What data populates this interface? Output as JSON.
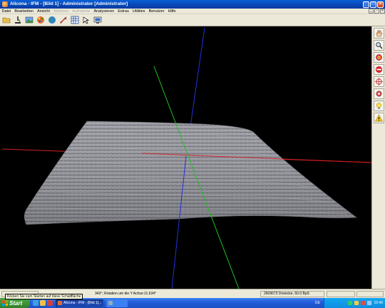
{
  "window": {
    "title": "Alicona - IFM - [Bild 1] - Administrator [Administrator]"
  },
  "menu": [
    {
      "label": "Datei",
      "enabled": true
    },
    {
      "label": "Bearbeiten",
      "enabled": true
    },
    {
      "label": "Ansicht",
      "enabled": true
    },
    {
      "label": "Aktionen",
      "enabled": false
    },
    {
      "label": "Aufnahme",
      "enabled": false
    },
    {
      "label": "Analysieren",
      "enabled": true
    },
    {
      "label": "Extras",
      "enabled": true
    },
    {
      "label": "Utilities",
      "enabled": true
    },
    {
      "label": "Benutzer",
      "enabled": true
    },
    {
      "label": "Hilfe",
      "enabled": true
    }
  ],
  "toolbar_icons": [
    "folder-icon",
    "microscope-icon",
    "landscape-image-icon",
    "color-palette-icon",
    "globe-icon",
    "measure-tool-icon",
    "grid-icon",
    "arrow-tool-icon",
    "screenshot-icon"
  ],
  "palette_icons": [
    "hand-icon",
    "zoom-icon",
    "rotate-icon",
    "stop-icon",
    "crosshair-icon",
    "settings-icon",
    "light-bulb-icon",
    "warning-icon"
  ],
  "status": {
    "rotation_text": "343°; Rotation um die Y Achse:11.634°",
    "triangles_text": "2609673 Dreiecke, 60.0 BpS"
  },
  "tooltip": "Klicken Sie zum Starten auf diese Schaltfläche",
  "taskbar": {
    "start_label": "Start",
    "tasks": [
      {
        "label": "Alicona - IFM - [Bild 1]...",
        "active": true
      },
      {
        "label": "",
        "active": false
      }
    ],
    "language": "DE",
    "clock": "15:46"
  },
  "colors": {
    "axis_x": "#d42020",
    "axis_y": "#20c020",
    "axis_z": "#2030e0",
    "surface": "#8e8e96",
    "viewport_bg": "#000000"
  }
}
